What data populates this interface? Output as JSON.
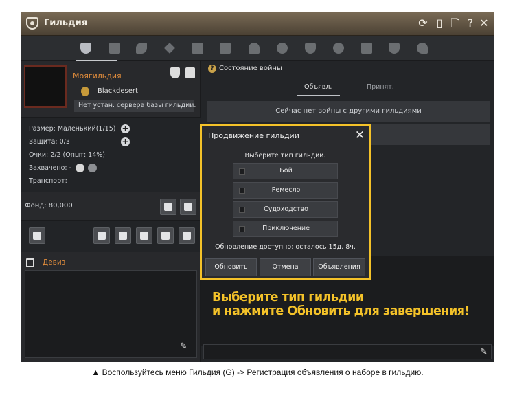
{
  "window": {
    "title": "Гильдия",
    "icons": [
      "guild-icon",
      "refresh-icon",
      "phone-icon",
      "document-icon",
      "help-icon",
      "close-icon"
    ]
  },
  "tabs": {
    "icons": [
      "guild-emblem-icon",
      "members-icon",
      "skills-icon",
      "crossed-swords-icon",
      "castle-icon",
      "scroll-icon",
      "bell-icon",
      "wings-icon",
      "shield-icon",
      "crest-icon",
      "quest-icon",
      "cross-shield-icon",
      "dragon-icon"
    ],
    "active_index": 0
  },
  "guild": {
    "name": "Моягильдия",
    "server_name": "Blackdesert",
    "no_server_text": "Нет устан. сервера базы гильдии.",
    "size": "Размер: Маленький(1/15)",
    "defense": "Защита: 0/3",
    "points": "Очки: 2/2 (Опыт: 14%)",
    "captured": "Захвачено: -",
    "transport": "Транспорт:",
    "fund": "Фонд: 80,000",
    "motto_label": "Девиз"
  },
  "war": {
    "title": "Состояние войны",
    "tab_announcements": "Объявл.",
    "tab_accepted": "Принят.",
    "no_war_text": "Сейчас нет войны с другими гильдиями"
  },
  "modal": {
    "title": "Продвижение гильдии",
    "prompt": "Выберите тип гильдии.",
    "options": [
      "Бой",
      "Ремесло",
      "Судоходство",
      "Приключение"
    ],
    "status": "Обновление доступно: осталось 15д. 8ч.",
    "btn_update": "Обновить",
    "btn_cancel": "Отмена",
    "btn_announcements": "Объявления"
  },
  "hint": {
    "line1": "Выберите тип гильдии",
    "line2": "и нажмите Обновить для завершения!"
  },
  "caption": "▲ Воспользуйтесь меню Гильдия (G) -> Регистрация объявления о наборе в гильдию.",
  "colors": {
    "highlight": "#f4c229",
    "guild_name": "#e08c3c",
    "emblem_border": "#6a2a1f"
  }
}
